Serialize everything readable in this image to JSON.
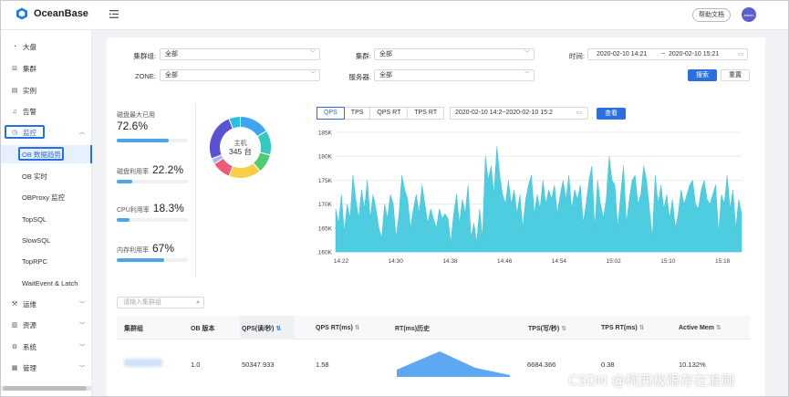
{
  "app": {
    "name": "OceanBase",
    "help_label": "帮助文档",
    "avatar_text": "admin"
  },
  "colors": {
    "primary": "#2a6ee0",
    "area": "#4fcde0",
    "bar_fill": "#4aa6e8"
  },
  "sidebar": {
    "items": [
      {
        "label": "大盘",
        "icon": "dashboard-icon"
      },
      {
        "label": "集群",
        "icon": "cluster-icon"
      },
      {
        "label": "实例",
        "icon": "instance-icon"
      },
      {
        "label": "告警",
        "icon": "bell-icon"
      },
      {
        "label": "监控",
        "icon": "monitor-icon",
        "expanded": true
      }
    ],
    "sub_items": [
      {
        "label": "OB 数据趋势",
        "active": true
      },
      {
        "label": "OB 实时"
      },
      {
        "label": "OBProxy 监控"
      },
      {
        "label": "TopSQL"
      },
      {
        "label": "SlowSQL"
      },
      {
        "label": "TopRPC"
      },
      {
        "label": "WaitEvent & Latch"
      }
    ],
    "bottom_items": [
      {
        "label": "运维",
        "icon": "wrench-icon"
      },
      {
        "label": "资源",
        "icon": "resource-icon"
      },
      {
        "label": "系统",
        "icon": "gear-icon"
      },
      {
        "label": "管理",
        "icon": "manage-icon"
      }
    ]
  },
  "filters": {
    "cluster_group_label": "集群组:",
    "cluster_group_value": "全部",
    "cluster_label": "集群:",
    "cluster_value": "全部",
    "time_label": "时间:",
    "time_start": "2020-02-10 14:21",
    "time_sep": "~",
    "time_end": "2020-02-10 15:21",
    "zone_label": "ZONE:",
    "zone_value": "全部",
    "server_label": "服务器:",
    "server_value": "全部",
    "search_label": "搜索",
    "reset_label": "重置"
  },
  "stats": [
    {
      "label": "磁盘最大已用",
      "value": "72.6%",
      "percent": 72.6
    },
    {
      "label": "磁盘利用率",
      "value": "22.2%",
      "percent": 22.2
    },
    {
      "label": "CPU利用率",
      "value": "18.3%",
      "percent": 18.3
    },
    {
      "label": "内存利用率",
      "value": "67%",
      "percent": 67
    }
  ],
  "donut": {
    "title": "主机",
    "count": "345 台",
    "segments": [
      {
        "value": 16,
        "color": "#3fa5f0"
      },
      {
        "value": 13,
        "color": "#35c9c0"
      },
      {
        "value": 10,
        "color": "#4fcc70"
      },
      {
        "value": 17,
        "color": "#f8cf49"
      },
      {
        "value": 10,
        "color": "#f05a79"
      },
      {
        "value": 3,
        "color": "#b2b3f7"
      },
      {
        "value": 25,
        "color": "#5a52d5"
      },
      {
        "value": 6,
        "color": "#29bfe3"
      }
    ]
  },
  "chart_tabs": [
    "QPS",
    "TPS",
    "QPS RT",
    "TPS RT"
  ],
  "chart_range": "2020-02-10 14:2~2020-02-10 15:2",
  "view_label": "查看",
  "chart_data": {
    "type": "area",
    "x_ticks": [
      "14:22",
      "14:30",
      "14:38",
      "14:46",
      "14:54",
      "15:02",
      "15:10",
      "15:18"
    ],
    "y_ticks": [
      "185K",
      "180K",
      "175K",
      "170K",
      "165K",
      "160K"
    ],
    "ylim": [
      160000,
      185000
    ],
    "grid": true,
    "values": [
      169000,
      166000,
      172000,
      164000,
      170000,
      167000,
      176000,
      171000,
      167000,
      173000,
      169000,
      175000,
      167000,
      172000,
      169000,
      165000,
      163000,
      170000,
      167000,
      172000,
      170000,
      163000,
      168000,
      176000,
      173000,
      171000,
      165000,
      169000,
      172000,
      168000,
      174000,
      170000,
      166000,
      169000,
      167000,
      165000,
      169000,
      167000,
      168000,
      167000,
      162000,
      168000,
      172000,
      166000,
      171000,
      168000,
      174000,
      163000,
      166000,
      162000,
      169000,
      163000,
      180000,
      175000,
      178000,
      172000,
      182000,
      176000,
      172000,
      170000,
      175000,
      170000,
      173000,
      168000,
      172000,
      165000,
      171000,
      174000,
      176000,
      168000,
      172000,
      169000,
      175000,
      170000,
      173000,
      171000,
      174000,
      168000,
      172000,
      175000,
      171000,
      176000,
      169000,
      173000,
      171000,
      174000,
      166000,
      170000,
      175000,
      178000,
      165000,
      175000,
      170000,
      167000,
      171000,
      180000,
      175000,
      174000,
      165000,
      172000,
      178000,
      166000,
      171000,
      175000,
      176000,
      170000,
      172000,
      178000,
      175000,
      169000,
      163000,
      176000,
      170000,
      174000,
      169000,
      172000,
      167000,
      171000,
      165000,
      168000,
      173000,
      170000,
      172000,
      174000,
      175000,
      170000,
      169000,
      173000,
      175000,
      171000,
      170000,
      172000,
      174000,
      164000,
      172000,
      170000,
      176000,
      169000,
      173000,
      165000,
      171000,
      168000
    ]
  },
  "table": {
    "search_placeholder": "请输入集群组",
    "columns": [
      "集群组",
      "OB 版本",
      "QPS(读/秒)",
      "QPS RT(ms)",
      "RT(ms)历史",
      "TPS(写/秒)",
      "TPS RT(ms)",
      "Active Mem"
    ],
    "row": {
      "ob_version": "1.0",
      "qps": "50347.933",
      "qps_rt": "1.58",
      "tps": "6684.366",
      "tps_rt": "0.38",
      "active_mem": "10.132%"
    }
  },
  "watermark": "CSDN @柯西极限存在准则"
}
